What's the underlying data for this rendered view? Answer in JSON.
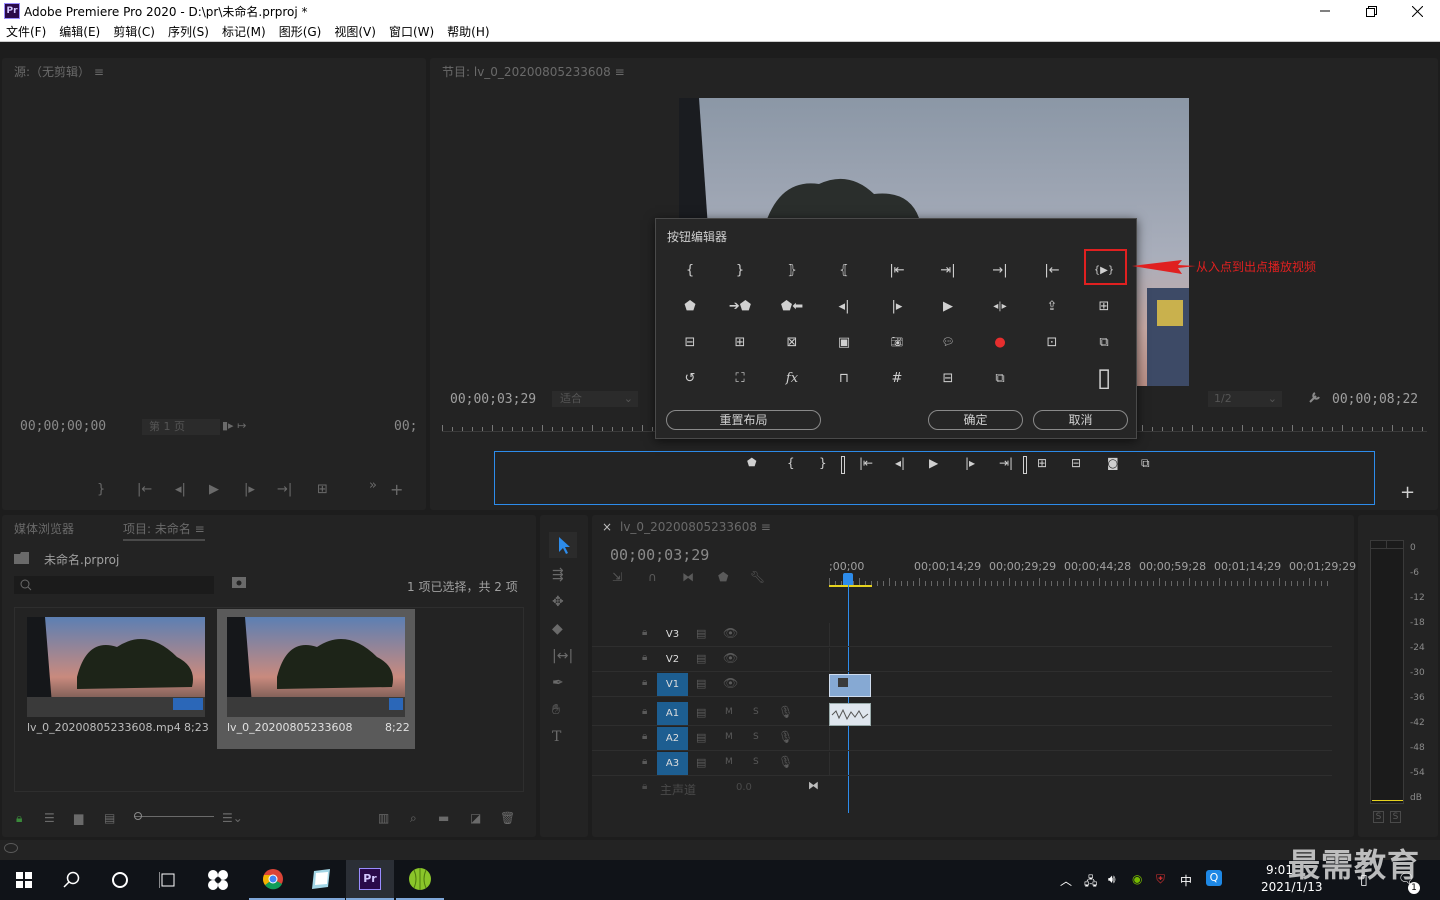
{
  "window": {
    "title": "Adobe Premiere Pro 2020 - D:\\pr\\未命名.prproj *",
    "app_icon": "Pr"
  },
  "menu": [
    "文件(F)",
    "编辑(E)",
    "剪辑(C)",
    "序列(S)",
    "标记(M)",
    "图形(G)",
    "视图(V)",
    "窗口(W)",
    "帮助(H)"
  ],
  "source": {
    "title": "源:（无剪辑）",
    "timecode": "00;00;00;00",
    "page": "第 1 页",
    "end_tc": "00;"
  },
  "program": {
    "title": "节目: lv_0_20200805233608",
    "timecode": "00;00;03;29",
    "fit": "适合",
    "quality": "1/2",
    "duration": "00;00;08;22"
  },
  "dialog": {
    "title": "按钮编辑器",
    "reset": "重置布局",
    "ok": "确定",
    "cancel": "取消"
  },
  "annotation": {
    "text": "从入点到出点播放视频",
    "color": "#e02020"
  },
  "project": {
    "tab_media": "媒体浏览器",
    "tab_project": "项目: 未命名",
    "file": "未命名.prproj",
    "selection": "1 项已选择，共 2 项",
    "items": [
      {
        "name": "lv_0_20200805233608.mp4",
        "duration": "8;23"
      },
      {
        "name": "lv_0_20200805233608",
        "duration": "8;22"
      }
    ]
  },
  "timeline": {
    "tab": "lv_0_20200805233608",
    "timecode": "00;00;03;29",
    "ruler": [
      ";00;00",
      "00;00;14;29",
      "00;00;29;29",
      "00;00;44;28",
      "00;00;59;28",
      "00;01;14;29",
      "00;01;29;29"
    ],
    "tracks": [
      "V3",
      "V2",
      "V1",
      "A1",
      "A2",
      "A3"
    ],
    "master": "主声道",
    "master_val": "0.0",
    "mute": "M",
    "solo": "S"
  },
  "meter": {
    "scale": [
      "0",
      "-6",
      "-12",
      "-18",
      "-24",
      "-30",
      "-36",
      "-42",
      "-48",
      "-54",
      "dB"
    ],
    "solo": "S"
  },
  "taskbar": {
    "time": "9:01",
    "date": "2021/1/13",
    "ime": "中",
    "notify_count": "1"
  },
  "watermark": "最需教育",
  "colors": {
    "accent_blue": "#2d8ceb",
    "track_active": "#1d5e91",
    "highlight_red": "#e02020",
    "record_red": "#e62e2e"
  }
}
